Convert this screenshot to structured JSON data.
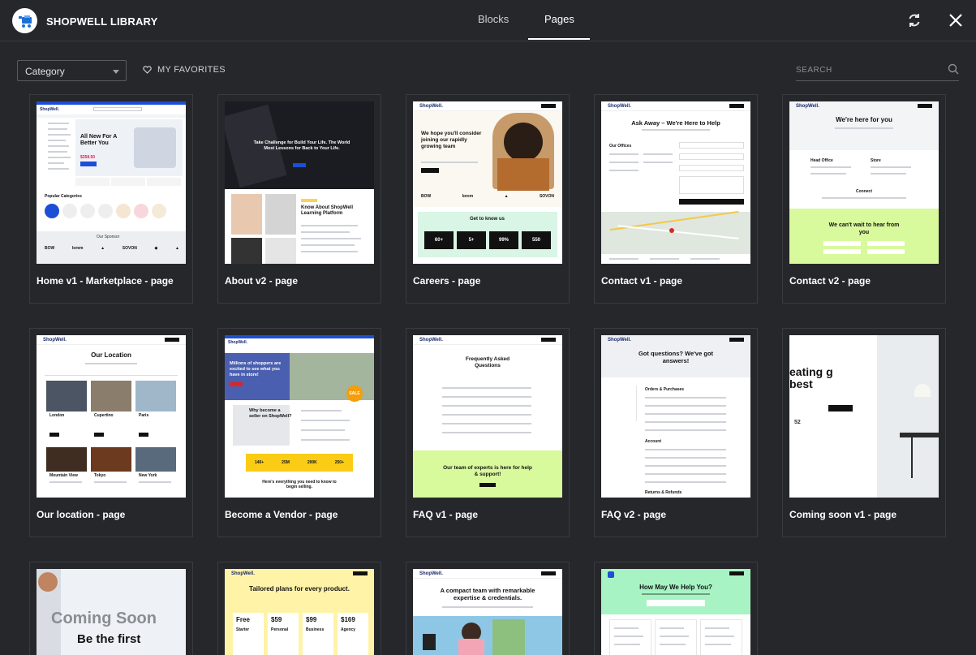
{
  "header": {
    "brand": "SHOPWELL LIBRARY",
    "tabs": [
      {
        "label": "Blocks",
        "active": false
      },
      {
        "label": "Pages",
        "active": true
      }
    ]
  },
  "toolbar": {
    "category_value": "Category",
    "favorites_label": "MY FAVORITES",
    "search_placeholder": "SEARCH"
  },
  "cards": [
    {
      "title": "Home v1 - Marketplace - page",
      "thumb": {
        "headline": "All New For A Better You",
        "price": "$358.50",
        "section": "Popular Categories",
        "footer": "Our Sponsor",
        "brands": [
          "BOW",
          "lorem",
          "▲",
          "SOVON",
          "◆",
          "▲"
        ]
      }
    },
    {
      "title": "About v2 - page",
      "thumb": {
        "headline": "Take Challenge for Build Your Life. The World Most Lessons for Back to Your Life.",
        "section": "Know About ShopWell Learning Platform"
      }
    },
    {
      "title": "Careers - page",
      "thumb": {
        "headline": "We hope you'll consider joining our rapidly growing team",
        "section": "Get to know us",
        "stats": [
          "60+",
          "5+",
          "99%",
          "550"
        ],
        "brands": [
          "BOW",
          "lorem",
          "▲",
          "SOVON"
        ]
      }
    },
    {
      "title": "Contact v1 - page",
      "thumb": {
        "headline": "Ask Away – We're Here to Help",
        "section": "Our Offices"
      }
    },
    {
      "title": "Contact v2 - page",
      "thumb": {
        "headline": "We're here for you",
        "section": "We can't wait to hear from you",
        "labels": [
          "Head Office",
          "Store",
          "Connect"
        ]
      }
    },
    {
      "title": "Our location - page",
      "thumb": {
        "headline": "Our Location",
        "cities": [
          "London",
          "Cupertino",
          "Paris",
          "Mountain View",
          "Tokyo",
          "New York"
        ]
      }
    },
    {
      "title": "Become a Vendor - page",
      "thumb": {
        "headline": "Millions of shoppers are excited to see what you have in store!",
        "section": "Why become a seller on ShopWell?",
        "stats": [
          "140+",
          "25M",
          "200K",
          "250+"
        ],
        "footer": "Here's everything you need to know to begin selling.",
        "badge": "SALE"
      }
    },
    {
      "title": "FAQ v1 - page",
      "thumb": {
        "headline": "Frequently Asked Questions",
        "section": "Our team of experts is here for help & support!"
      }
    },
    {
      "title": "FAQ v2 - page",
      "thumb": {
        "headline": "Got questions? We've got answers!",
        "labels": [
          "Orders & Purchases",
          "Account",
          "Returns & Refunds"
        ]
      }
    },
    {
      "title": "Coming soon v1 - page",
      "thumb": {
        "headline": "eating g best",
        "number": "52"
      }
    },
    {
      "title": "",
      "thumb": {
        "headline": "Coming Soon",
        "sub": "Be the first"
      }
    },
    {
      "title": "",
      "thumb": {
        "headline": "Tailored plans for every product.",
        "plans": [
          {
            "name": "Free",
            "tier": "Starter"
          },
          {
            "name": "$59",
            "tier": "Personal"
          },
          {
            "name": "$99",
            "tier": "Business"
          },
          {
            "name": "$169",
            "tier": "Agency"
          }
        ]
      }
    },
    {
      "title": "",
      "thumb": {
        "headline": "A compact team with remarkable expertise & credentials."
      }
    },
    {
      "title": "",
      "thumb": {
        "headline": "How May We Help You?"
      }
    }
  ]
}
